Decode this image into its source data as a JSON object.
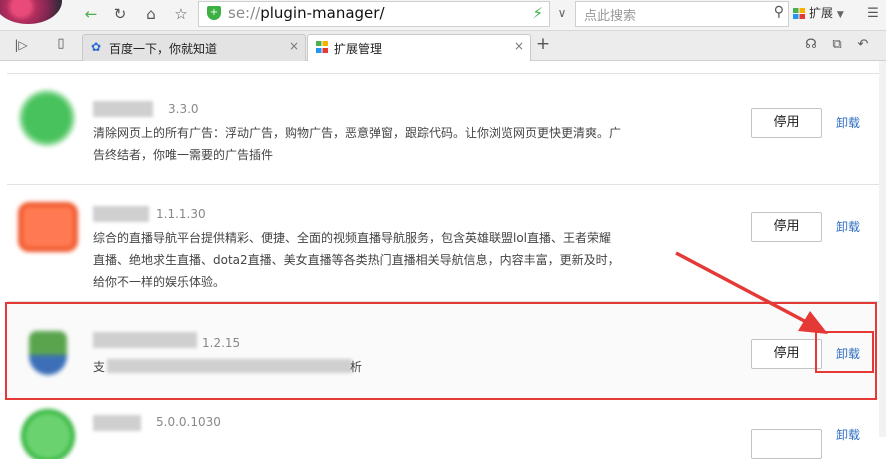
{
  "browser": {
    "url_scheme": "se://",
    "url_path": "plugin-manager/",
    "search_placeholder": "点此搜索",
    "extensions_label": "扩展",
    "tabs": [
      {
        "label": "百度一下，你就知道",
        "close": "×"
      },
      {
        "label": "扩展管理",
        "close": "×"
      }
    ],
    "new_tab": "+"
  },
  "extensions": [
    {
      "version": "3.3.0",
      "description": "清除网页上的所有广告：浮动广告，购物广告，恶意弹窗，跟踪代码。让你浏览网页更快更清爽。广\n告终结者，你唯一需要的广告插件",
      "disable_label": "停用",
      "uninstall_label": "卸载"
    },
    {
      "version": "1.1.1.30",
      "description": "综合的直播导航平台提供精彩、便捷、全面的视频直播导航服务，包含英雄联盟lol直播、王者荣耀\n直播、绝地求生直播、dota2直播、美女直播等各类热门直播相关导航信息，内容丰富，更新及时，\n给你不一样的娱乐体验。",
      "disable_label": "停用",
      "uninstall_label": "卸载"
    },
    {
      "version": "1.2.15",
      "description_start": "支",
      "description_end": "析",
      "disable_label": "停用",
      "uninstall_label": "卸载"
    },
    {
      "version": "5.0.0.1030",
      "uninstall_label": "卸载"
    }
  ],
  "colors": {
    "annotation": "#e53935",
    "link": "#2f6fc2"
  }
}
